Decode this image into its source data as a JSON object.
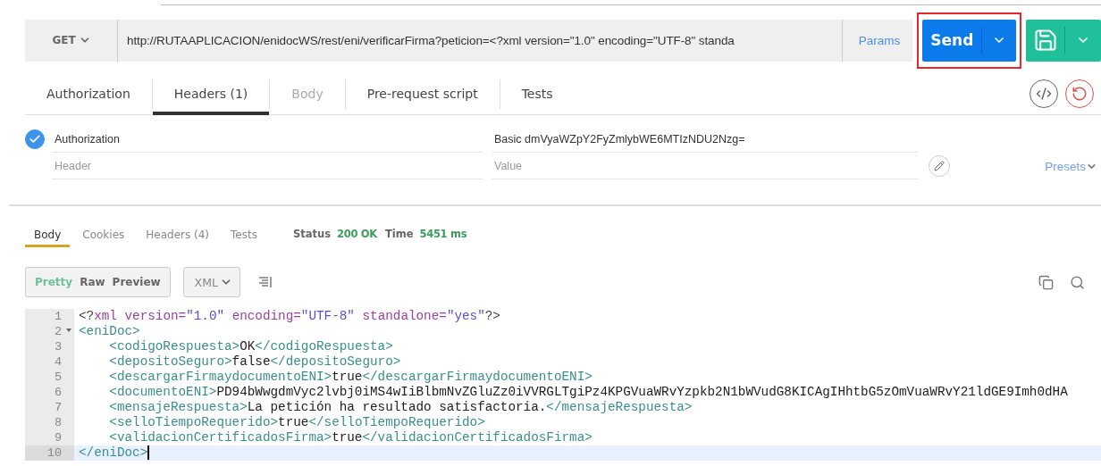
{
  "request": {
    "method": "GET",
    "url": "http://RUTAAPLICACION/enidocWS/rest/eni/verificarFirma?peticion=<?xml version=\"1.0\" encoding=\"UTF-8\" standa",
    "params_label": "Params",
    "send_label": "Send",
    "send_highlighted": true
  },
  "request_tabs": [
    {
      "label": "Authorization",
      "selected": false,
      "disabled": false
    },
    {
      "label": "Headers (1)",
      "selected": true,
      "disabled": false
    },
    {
      "label": "Body",
      "selected": false,
      "disabled": true
    },
    {
      "label": "Pre-request script",
      "selected": false,
      "disabled": false
    },
    {
      "label": "Tests",
      "selected": false,
      "disabled": false
    }
  ],
  "headers": [
    {
      "key": "Authorization",
      "value": "Basic dmVyaWZpY2FyZmlybWE6MTIzNDU2Nzg=",
      "checked": true
    }
  ],
  "new_header": {
    "key_placeholder": "Header",
    "value_placeholder": "Value"
  },
  "presets_label": "Presets",
  "response_tabs": [
    {
      "label": "Body",
      "selected": true
    },
    {
      "label": "Cookies",
      "selected": false
    },
    {
      "label": "Headers (4)",
      "selected": false
    },
    {
      "label": "Tests",
      "selected": false
    }
  ],
  "status": {
    "status_label": "Status",
    "status": "200 OK",
    "time_label": "Time",
    "time": "5451 ms"
  },
  "view_modes": [
    {
      "label": "Pretty",
      "selected": true
    },
    {
      "label": "Raw",
      "selected": false
    },
    {
      "label": "Preview",
      "selected": false
    }
  ],
  "format": "XML",
  "code_lines": [
    {
      "number": "1",
      "foldable": false,
      "active": false,
      "tokens": [
        {
          "kind": "punct",
          "text": "<?"
        },
        {
          "kind": "attr",
          "text": "xml version="
        },
        {
          "kind": "string",
          "text": "\"1.0\""
        },
        {
          "kind": "attr",
          "text": " encoding="
        },
        {
          "kind": "string",
          "text": "\"UTF-8\""
        },
        {
          "kind": "attr",
          "text": " standalone="
        },
        {
          "kind": "string",
          "text": "\"yes\""
        },
        {
          "kind": "punct",
          "text": "?>"
        }
      ]
    },
    {
      "number": "2",
      "foldable": true,
      "active": false,
      "tokens": [
        {
          "kind": "tag",
          "text": "<eniDoc>"
        }
      ]
    },
    {
      "number": "3",
      "foldable": false,
      "active": false,
      "tokens": [
        {
          "kind": "tag",
          "text": "    <codigoRespuesta>"
        },
        {
          "kind": "text",
          "text": "OK"
        },
        {
          "kind": "tag",
          "text": "</codigoRespuesta>"
        }
      ]
    },
    {
      "number": "4",
      "foldable": false,
      "active": false,
      "tokens": [
        {
          "kind": "tag",
          "text": "    <depositoSeguro>"
        },
        {
          "kind": "text",
          "text": "false"
        },
        {
          "kind": "tag",
          "text": "</depositoSeguro>"
        }
      ]
    },
    {
      "number": "5",
      "foldable": false,
      "active": false,
      "tokens": [
        {
          "kind": "tag",
          "text": "    <descargarFirmaydocumentoENI>"
        },
        {
          "kind": "text",
          "text": "true"
        },
        {
          "kind": "tag",
          "text": "</descargarFirmaydocumentoENI>"
        }
      ]
    },
    {
      "number": "6",
      "foldable": false,
      "active": false,
      "tokens": [
        {
          "kind": "tag",
          "text": "    <documentoENI>"
        },
        {
          "kind": "text",
          "text": "PD94bWwgdmVyc2lvbj0iMS4wIiBlbmNvZGluZz0iVVRGLTgiPz4KPGVuaWRvYzpkb2N1bWVudG8KICAgIHhtbG5zOmVuaWRvY21ldGE9Imh0dHA"
        }
      ]
    },
    {
      "number": "7",
      "foldable": false,
      "active": false,
      "tokens": [
        {
          "kind": "tag",
          "text": "    <mensajeRespuesta>"
        },
        {
          "kind": "text",
          "text": "La petición ha resultado satisfactoria."
        },
        {
          "kind": "tag",
          "text": "</mensajeRespuesta>"
        }
      ]
    },
    {
      "number": "8",
      "foldable": false,
      "active": false,
      "tokens": [
        {
          "kind": "tag",
          "text": "    <selloTiempoRequerido>"
        },
        {
          "kind": "text",
          "text": "true"
        },
        {
          "kind": "tag",
          "text": "</selloTiempoRequerido>"
        }
      ]
    },
    {
      "number": "9",
      "foldable": false,
      "active": false,
      "tokens": [
        {
          "kind": "tag",
          "text": "    <validacionCertificadosFirma>"
        },
        {
          "kind": "text",
          "text": "true"
        },
        {
          "kind": "tag",
          "text": "</validacionCertificadosFirma>"
        }
      ]
    },
    {
      "number": "10",
      "foldable": false,
      "active": true,
      "tokens": [
        {
          "kind": "tag",
          "text": "</eniDoc>"
        }
      ]
    }
  ]
}
